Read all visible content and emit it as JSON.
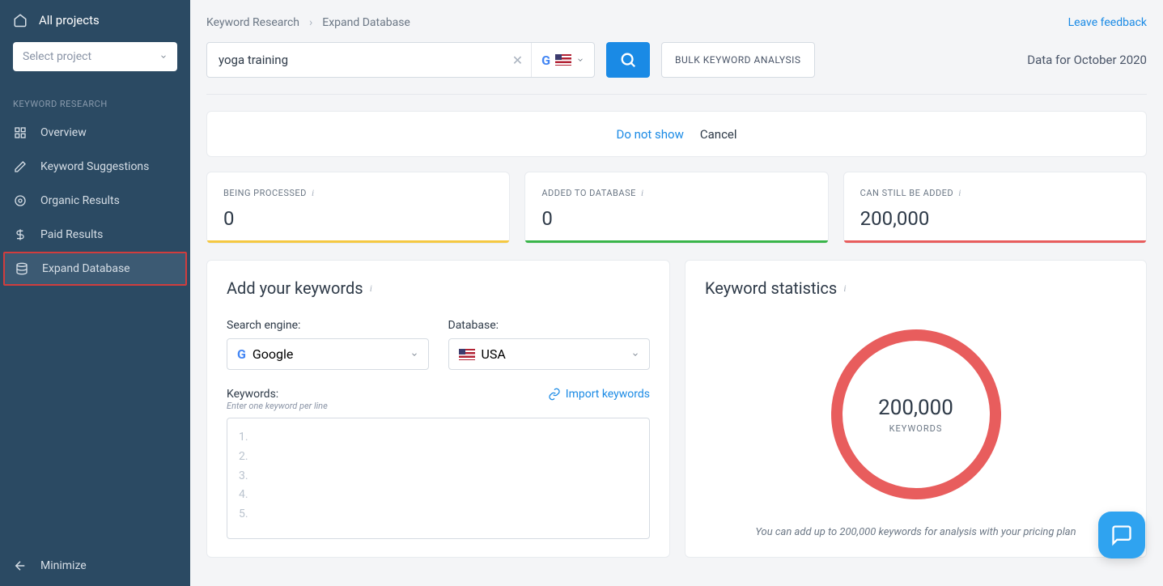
{
  "sidebar": {
    "all_projects": "All projects",
    "select_placeholder": "Select project",
    "section": "KEYWORD RESEARCH",
    "items": [
      {
        "label": "Overview"
      },
      {
        "label": "Keyword Suggestions"
      },
      {
        "label": "Organic Results"
      },
      {
        "label": "Paid Results"
      },
      {
        "label": "Expand Database"
      }
    ],
    "minimize": "Minimize"
  },
  "breadcrumb": {
    "a": "Keyword Research",
    "b": "Expand Database"
  },
  "feedback": "Leave feedback",
  "search": {
    "value": "yoga training",
    "bulk": "BULK KEYWORD ANALYSIS"
  },
  "data_for": "Data for October 2020",
  "banner": {
    "dns": "Do not show",
    "cancel": "Cancel"
  },
  "stats": {
    "processed": {
      "label": "BEING PROCESSED",
      "value": "0"
    },
    "added": {
      "label": "ADDED TO DATABASE",
      "value": "0"
    },
    "remaining": {
      "label": "CAN STILL BE ADDED",
      "value": "200,000"
    }
  },
  "add_panel": {
    "title": "Add your keywords",
    "engine_label": "Search engine:",
    "engine_value": "Google",
    "db_label": "Database:",
    "db_value": "USA",
    "kw_label": "Keywords:",
    "kw_hint": "Enter one keyword per line",
    "import": "Import keywords",
    "lines": [
      "1.",
      "2.",
      "3.",
      "4.",
      "5."
    ]
  },
  "stats_panel": {
    "title": "Keyword statistics",
    "donut_number": "200,000",
    "donut_label": "KEYWORDS",
    "note": "You can add up to 200,000 keywords for analysis with your pricing plan"
  }
}
